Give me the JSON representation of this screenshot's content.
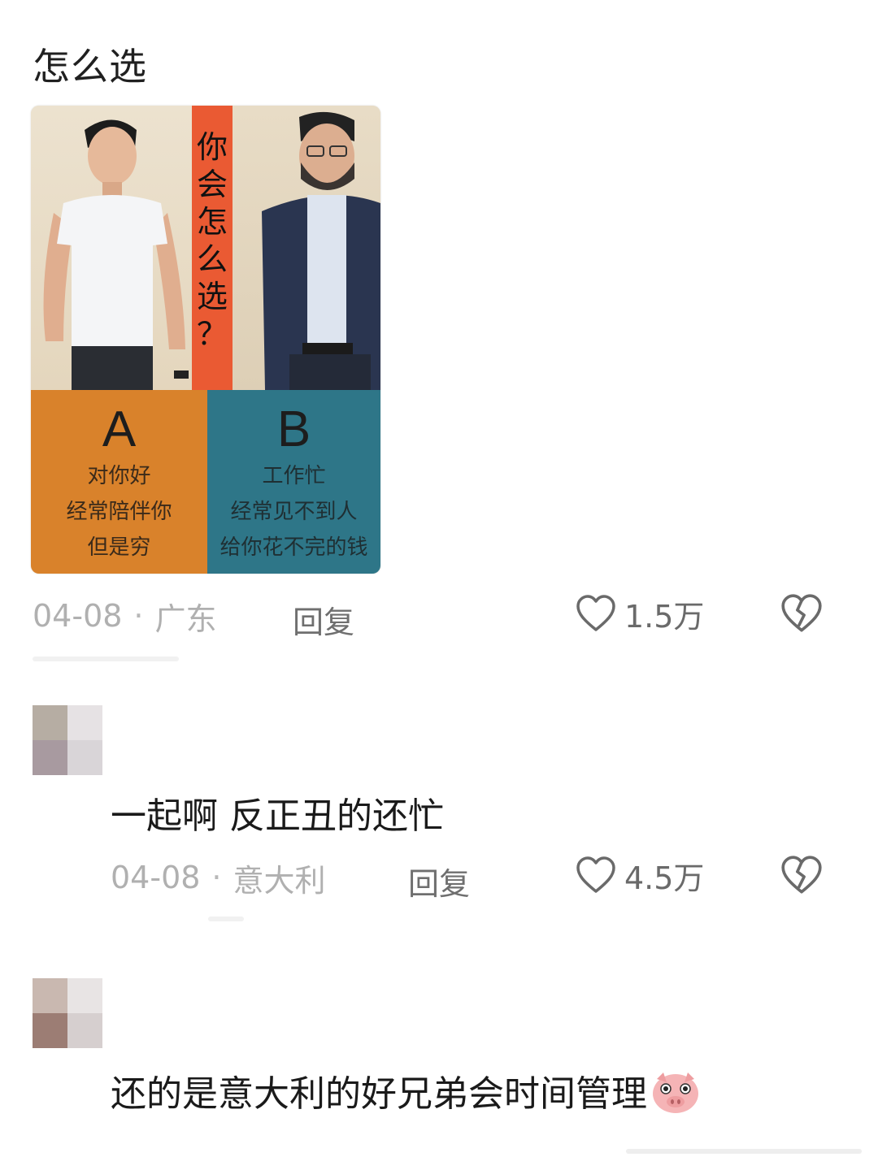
{
  "post": {
    "title": "怎么选",
    "image": {
      "question_chars": [
        "你",
        "会",
        "怎",
        "么",
        "选",
        "？"
      ],
      "option_a": {
        "letter": "A",
        "lines": [
          "对你好",
          "经常陪伴你",
          "但是穷"
        ]
      },
      "option_b": {
        "letter": "B",
        "lines": [
          "工作忙",
          "经常见不到人",
          "给你花不完的钱"
        ]
      }
    },
    "meta": {
      "date": "04-08",
      "location": "广东",
      "reply": "回复",
      "likes": "1.5万"
    }
  },
  "comments": [
    {
      "text": "一起啊 反正丑的还忙",
      "meta": {
        "date": "04-08",
        "location": "意大利",
        "reply": "回复",
        "likes": "4.5万"
      }
    },
    {
      "text": "还的是意大利的好兄弟会时间管理"
    }
  ],
  "icons": {
    "like": "heart-outline-icon",
    "dislike": "broken-heart-icon",
    "emoji": "pig-face-emoji-icon"
  },
  "colors": {
    "option_a": "#d9822b",
    "option_b": "#2e7688",
    "question_band": "#ea5a33",
    "meta_text": "#a3a3a3"
  }
}
